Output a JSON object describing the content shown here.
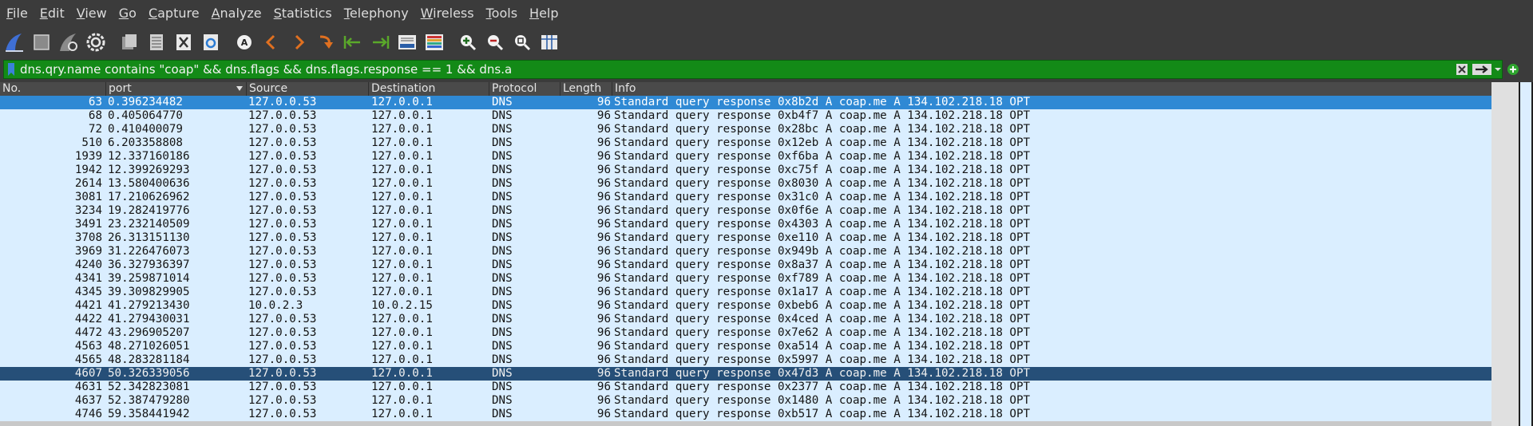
{
  "menu": [
    "File",
    "Edit",
    "View",
    "Go",
    "Capture",
    "Analyze",
    "Statistics",
    "Telephony",
    "Wireless",
    "Tools",
    "Help"
  ],
  "toolbar_icons": [
    "shark-fin-start-icon",
    "stop-capture-icon",
    "restart-capture-icon",
    "capture-options-icon",
    "open-file-icon",
    "save-file-icon",
    "close-file-icon",
    "reload-file-icon",
    "find-packet-icon",
    "go-back-icon",
    "go-forward-icon",
    "go-to-packet-icon",
    "first-packet-icon",
    "last-packet-icon",
    "autoscroll-icon",
    "colorize-icon",
    "zoom-in-icon",
    "zoom-out-icon",
    "normal-size-icon",
    "resize-columns-icon"
  ],
  "filter": {
    "text": "dns.qry.name contains \"coap\" && dns.flags && dns.flags.response == 1 && dns.a",
    "bg_color": "#138a17"
  },
  "columns": [
    "No.",
    "port",
    "Source",
    "Destination",
    "Protocol",
    "Length",
    "Info"
  ],
  "colors": {
    "row_bg": "#daeeff",
    "selected_row": "#2f89d4",
    "highlight_row": "#264f78"
  },
  "packets": [
    {
      "no": "63",
      "time": "0.396234482",
      "src": "127.0.0.53",
      "dst": "127.0.0.1",
      "proto": "DNS",
      "len": "96",
      "info": "Standard query response 0x8b2d A coap.me A 134.102.218.18 OPT"
    },
    {
      "no": "68",
      "time": "0.405064770",
      "src": "127.0.0.53",
      "dst": "127.0.0.1",
      "proto": "DNS",
      "len": "96",
      "info": "Standard query response 0xb4f7 A coap.me A 134.102.218.18 OPT"
    },
    {
      "no": "72",
      "time": "0.410400079",
      "src": "127.0.0.53",
      "dst": "127.0.0.1",
      "proto": "DNS",
      "len": "96",
      "info": "Standard query response 0x28bc A coap.me A 134.102.218.18 OPT"
    },
    {
      "no": "510",
      "time": "6.203358808",
      "src": "127.0.0.53",
      "dst": "127.0.0.1",
      "proto": "DNS",
      "len": "96",
      "info": "Standard query response 0x12eb A coap.me A 134.102.218.18 OPT"
    },
    {
      "no": "1939",
      "time": "12.337160186",
      "src": "127.0.0.53",
      "dst": "127.0.0.1",
      "proto": "DNS",
      "len": "96",
      "info": "Standard query response 0xf6ba A coap.me A 134.102.218.18 OPT"
    },
    {
      "no": "1942",
      "time": "12.399269293",
      "src": "127.0.0.53",
      "dst": "127.0.0.1",
      "proto": "DNS",
      "len": "96",
      "info": "Standard query response 0xc75f A coap.me A 134.102.218.18 OPT"
    },
    {
      "no": "2614",
      "time": "13.580400636",
      "src": "127.0.0.53",
      "dst": "127.0.0.1",
      "proto": "DNS",
      "len": "96",
      "info": "Standard query response 0x8030 A coap.me A 134.102.218.18 OPT"
    },
    {
      "no": "3081",
      "time": "17.210626962",
      "src": "127.0.0.53",
      "dst": "127.0.0.1",
      "proto": "DNS",
      "len": "96",
      "info": "Standard query response 0x31c0 A coap.me A 134.102.218.18 OPT"
    },
    {
      "no": "3234",
      "time": "19.282419776",
      "src": "127.0.0.53",
      "dst": "127.0.0.1",
      "proto": "DNS",
      "len": "96",
      "info": "Standard query response 0x0f6e A coap.me A 134.102.218.18 OPT"
    },
    {
      "no": "3491",
      "time": "23.232140509",
      "src": "127.0.0.53",
      "dst": "127.0.0.1",
      "proto": "DNS",
      "len": "96",
      "info": "Standard query response 0x4303 A coap.me A 134.102.218.18 OPT"
    },
    {
      "no": "3708",
      "time": "26.313151130",
      "src": "127.0.0.53",
      "dst": "127.0.0.1",
      "proto": "DNS",
      "len": "96",
      "info": "Standard query response 0xe110 A coap.me A 134.102.218.18 OPT"
    },
    {
      "no": "3969",
      "time": "31.226476073",
      "src": "127.0.0.53",
      "dst": "127.0.0.1",
      "proto": "DNS",
      "len": "96",
      "info": "Standard query response 0x949b A coap.me A 134.102.218.18 OPT"
    },
    {
      "no": "4240",
      "time": "36.327936397",
      "src": "127.0.0.53",
      "dst": "127.0.0.1",
      "proto": "DNS",
      "len": "96",
      "info": "Standard query response 0x8a37 A coap.me A 134.102.218.18 OPT"
    },
    {
      "no": "4341",
      "time": "39.259871014",
      "src": "127.0.0.53",
      "dst": "127.0.0.1",
      "proto": "DNS",
      "len": "96",
      "info": "Standard query response 0xf789 A coap.me A 134.102.218.18 OPT"
    },
    {
      "no": "4345",
      "time": "39.309829905",
      "src": "127.0.0.53",
      "dst": "127.0.0.1",
      "proto": "DNS",
      "len": "96",
      "info": "Standard query response 0x1a17 A coap.me A 134.102.218.18 OPT"
    },
    {
      "no": "4421",
      "time": "41.279213430",
      "src": "10.0.2.3",
      "dst": "10.0.2.15",
      "proto": "DNS",
      "len": "96",
      "info": "Standard query response 0xbeb6 A coap.me A 134.102.218.18 OPT"
    },
    {
      "no": "4422",
      "time": "41.279430031",
      "src": "127.0.0.53",
      "dst": "127.0.0.1",
      "proto": "DNS",
      "len": "96",
      "info": "Standard query response 0x4ced A coap.me A 134.102.218.18 OPT"
    },
    {
      "no": "4472",
      "time": "43.296905207",
      "src": "127.0.0.53",
      "dst": "127.0.0.1",
      "proto": "DNS",
      "len": "96",
      "info": "Standard query response 0x7e62 A coap.me A 134.102.218.18 OPT"
    },
    {
      "no": "4563",
      "time": "48.271026051",
      "src": "127.0.0.53",
      "dst": "127.0.0.1",
      "proto": "DNS",
      "len": "96",
      "info": "Standard query response 0xa514 A coap.me A 134.102.218.18 OPT"
    },
    {
      "no": "4565",
      "time": "48.283281184",
      "src": "127.0.0.53",
      "dst": "127.0.0.1",
      "proto": "DNS",
      "len": "96",
      "info": "Standard query response 0x5997 A coap.me A 134.102.218.18 OPT"
    },
    {
      "no": "4607",
      "time": "50.326339056",
      "src": "127.0.0.53",
      "dst": "127.0.0.1",
      "proto": "DNS",
      "len": "96",
      "info": "Standard query response 0x47d3 A coap.me A 134.102.218.18 OPT"
    },
    {
      "no": "4631",
      "time": "52.342823081",
      "src": "127.0.0.53",
      "dst": "127.0.0.1",
      "proto": "DNS",
      "len": "96",
      "info": "Standard query response 0x2377 A coap.me A 134.102.218.18 OPT"
    },
    {
      "no": "4637",
      "time": "52.387479280",
      "src": "127.0.0.53",
      "dst": "127.0.0.1",
      "proto": "DNS",
      "len": "96",
      "info": "Standard query response 0x1480 A coap.me A 134.102.218.18 OPT"
    },
    {
      "no": "4746",
      "time": "59.358441942",
      "src": "127.0.0.53",
      "dst": "127.0.0.1",
      "proto": "DNS",
      "len": "96",
      "info": "Standard query response 0xb517 A coap.me A 134.102.218.18 OPT"
    }
  ]
}
